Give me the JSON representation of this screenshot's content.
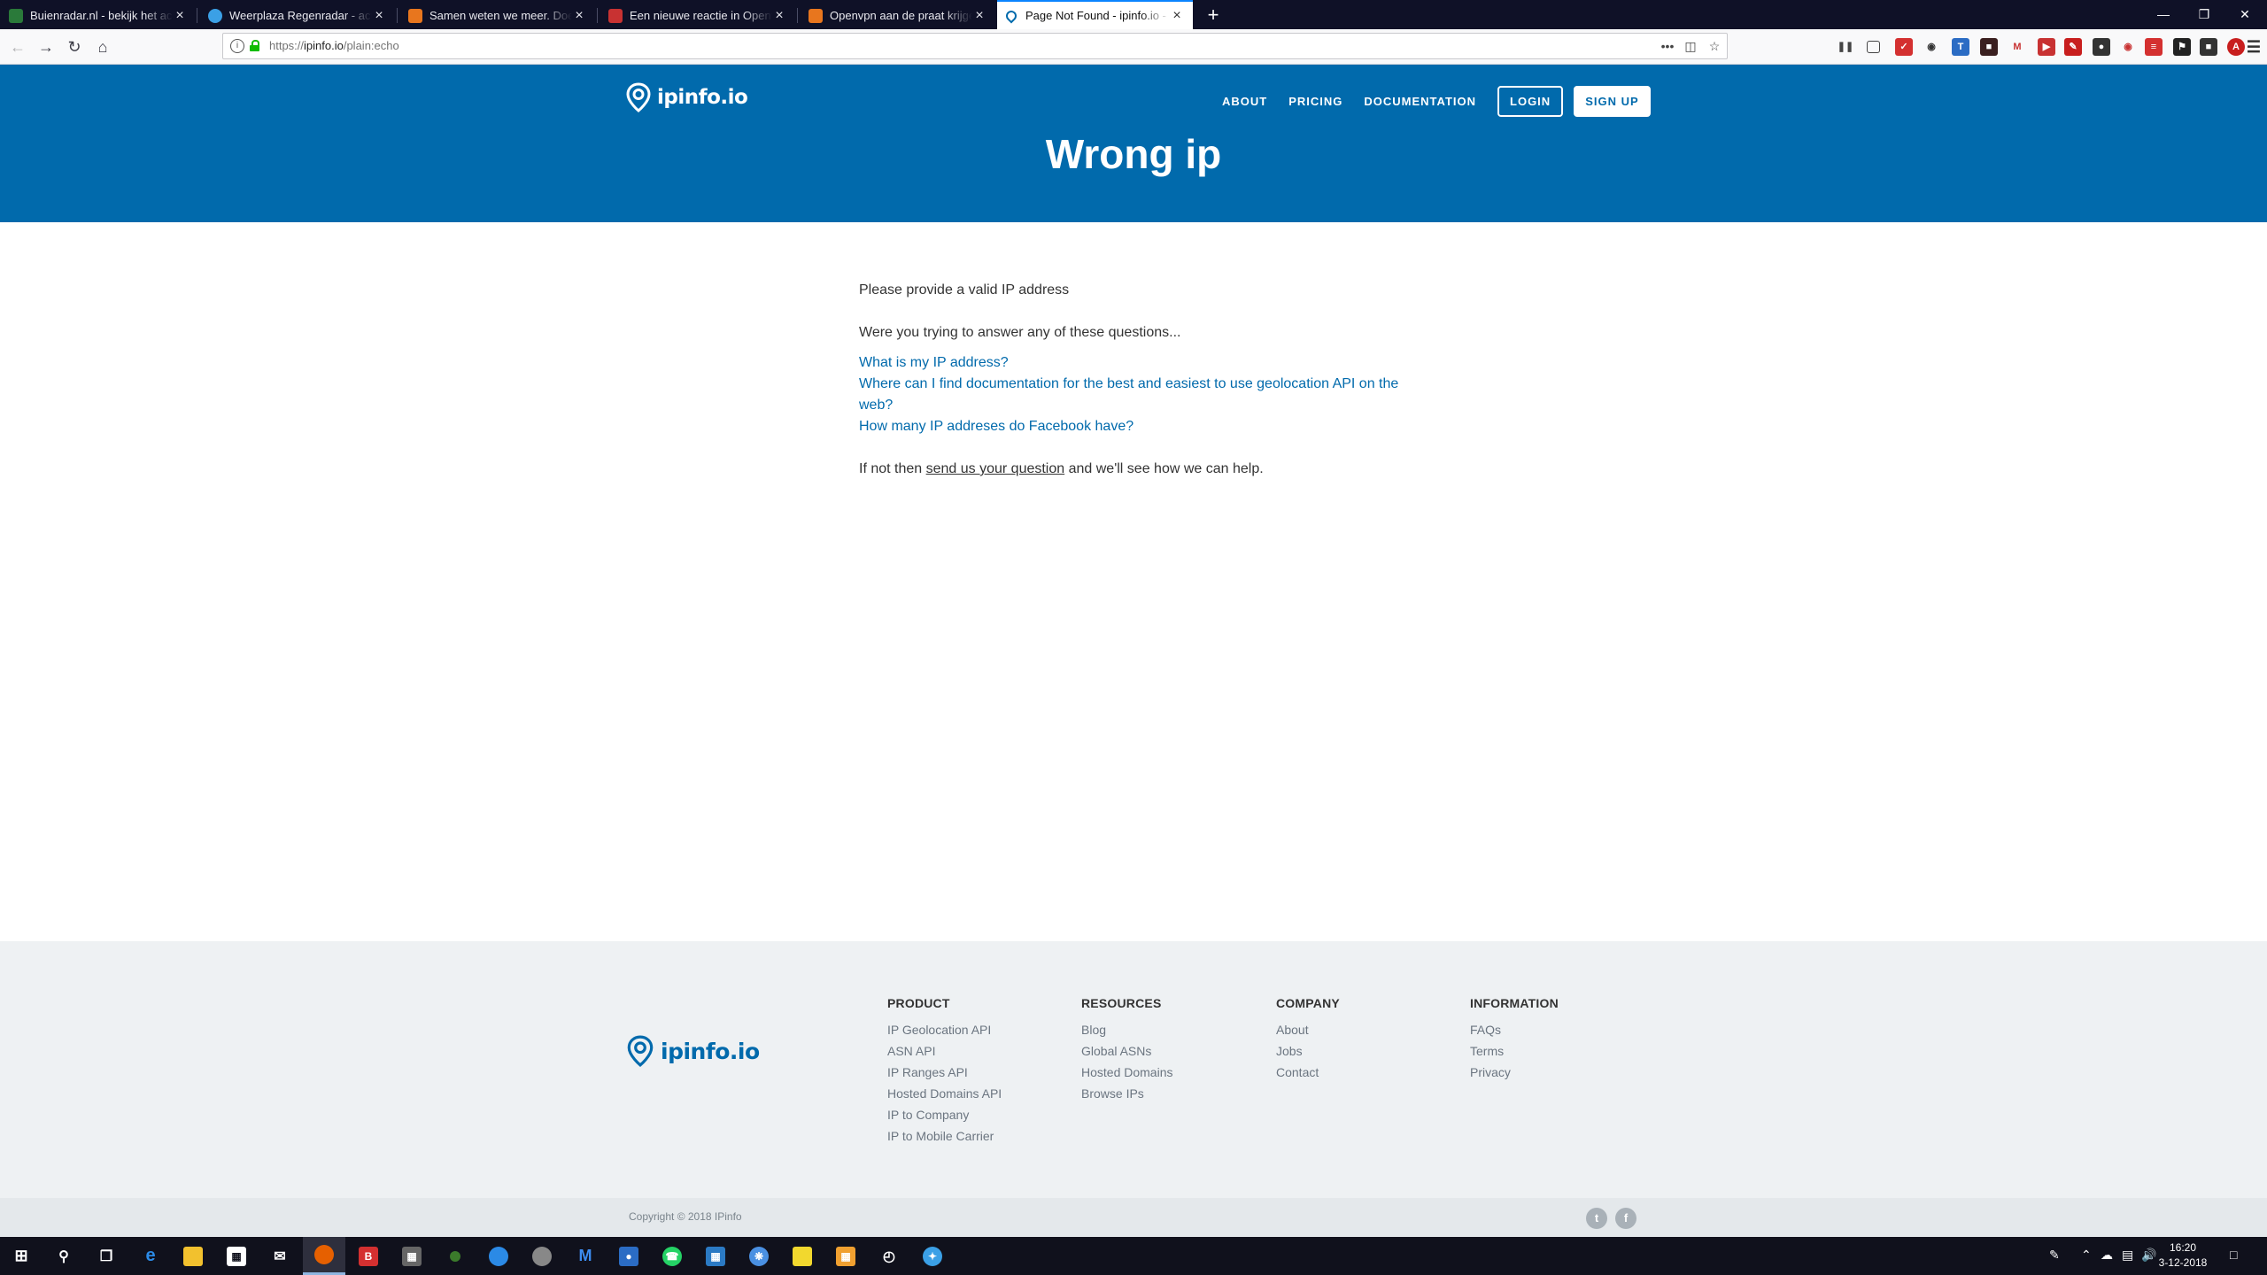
{
  "browser": {
    "tabs": [
      {
        "title": "Buienradar.nl - bekijk het actuele weer",
        "color": "#2a7a3a"
      },
      {
        "title": "Weerplaza Regenradar - actuele neerslag",
        "color": "#3ba0e6"
      },
      {
        "title": "Samen weten we meer. Doe je mee?",
        "color": "#e8761e"
      },
      {
        "title": "Een nieuwe reactie in Openvpn",
        "color": "#c83232"
      },
      {
        "title": "Openvpn aan de praat krijgen",
        "color": "#e8761e"
      },
      {
        "title": "Page Not Found - ipinfo.io - IP",
        "color": "#016aac"
      }
    ],
    "url_prefix": "https://",
    "url_host": "ipinfo.io",
    "url_path": "/plain:echo",
    "new_tab": "+",
    "page_actions": [
      "•••",
      "◫",
      "☆"
    ]
  },
  "site": {
    "logo_text": "ipinfo.io",
    "nav": [
      "ABOUT",
      "PRICING",
      "DOCUMENTATION"
    ],
    "login": "LOGIN",
    "signup": "SIGN UP",
    "heading": "Wrong ip"
  },
  "content": {
    "message": "Please provide a valid IP address",
    "lead": "Were you trying to answer any of these questions...",
    "questions": [
      "What is my IP address?",
      "Where can I find documentation for the best and easiest to use geolocation API on the web?",
      "How many IP addreses do Facebook have?"
    ],
    "help_before": "If not then ",
    "help_link": "send us your question",
    "help_after": " and we'll see how we can help."
  },
  "footer": {
    "columns": [
      {
        "heading": "PRODUCT",
        "links": [
          "IP Geolocation API",
          "ASN API",
          "IP Ranges API",
          "Hosted Domains API",
          "IP to Company",
          "IP to Mobile Carrier"
        ]
      },
      {
        "heading": "RESOURCES",
        "links": [
          "Blog",
          "Global ASNs",
          "Hosted Domains",
          "Browse IPs"
        ]
      },
      {
        "heading": "COMPANY",
        "links": [
          "About",
          "Jobs",
          "Contact"
        ]
      },
      {
        "heading": "INFORMATION",
        "links": [
          "FAQs",
          "Terms",
          "Privacy"
        ]
      }
    ],
    "copyright": "Copyright © 2018 IPinfo",
    "social": [
      "twitter-icon",
      "facebook-icon"
    ]
  },
  "taskbar": {
    "time": "16:20",
    "date": "3-12-2018"
  },
  "colors": {
    "brand": "#016aac",
    "link": "#016aac",
    "footer_bg": "#eef1f3"
  }
}
